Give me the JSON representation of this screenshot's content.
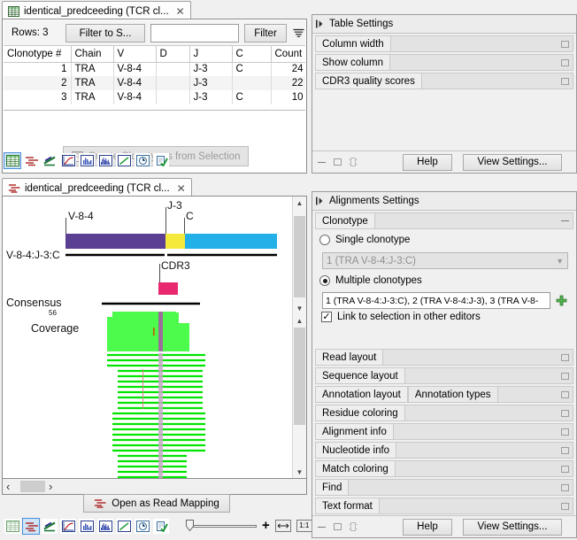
{
  "top_view": {
    "tab": {
      "title": "identical_predceeding (TCR cl...",
      "close": "✕",
      "icon": "table-grid-icon"
    },
    "toolbar": {
      "rows_label": "Rows: 3",
      "filter_to_selection": "Filter to S...",
      "search_value": "",
      "search_placeholder": "",
      "filter_button": "Filter",
      "filter_menu_icon": "filter-menu-icon"
    },
    "table": {
      "columns": [
        "Clonotype #",
        "Chain",
        "V",
        "D",
        "J",
        "C",
        "Count"
      ],
      "rows": [
        {
          "clonotype": "1",
          "chain": "TRA",
          "v": "V-8-4",
          "d": "",
          "j": "J-3",
          "c": "C",
          "count": "24"
        },
        {
          "clonotype": "2",
          "chain": "TRA",
          "v": "V-8-4",
          "d": "",
          "j": "J-3",
          "c": "",
          "count": "22"
        },
        {
          "clonotype": "3",
          "chain": "TRA",
          "v": "V-8-4",
          "d": "",
          "j": "J-3",
          "c": "C",
          "count": "10"
        }
      ]
    },
    "create_button": "Create Clonotypes from Selection",
    "view_icons": [
      "table-view-icon",
      "read-mapping-view-icon",
      "alignment-view-icon",
      "line-chart-view-icon",
      "histogram-view-icon",
      "bar-chart-view-icon",
      "trend-chart-view-icon",
      "circular-view-icon",
      "report-view-icon"
    ],
    "selected_view_icon": 0
  },
  "table_settings": {
    "header": "Table Settings",
    "expand_icon": "expand-arrow-icon",
    "groups": [
      {
        "label": "Column width",
        "icon": "restore-icon"
      },
      {
        "label": "Show column",
        "icon": "restore-icon"
      },
      {
        "label": "CDR3 quality scores",
        "icon": "restore-icon"
      }
    ],
    "footer": {
      "minimize_icon": "minimize-icon",
      "restore_icon": "restore-icon",
      "dock_icon": "dock-icon",
      "help": "Help",
      "view_settings": "View Settings..."
    }
  },
  "bottom_view": {
    "tab": {
      "title": "identical_predceeding (TCR cl...",
      "close": "✕",
      "icon": "read-mapping-icon"
    },
    "graphic": {
      "segment_labels": [
        "V-8-4",
        "J-3",
        "C"
      ],
      "reference_name": "V-8-4:J-3:C",
      "annotation_label": "CDR3",
      "consensus_label": "Consensus",
      "consensus_value": "56",
      "coverage_label": "Coverage",
      "colors": {
        "v_segment": "#5b3f93",
        "j_segment": "#f5e93b",
        "c_segment": "#23b0e8",
        "cdr3": "#e8286f",
        "coverage": "#4dfb4d",
        "read": "#00e400",
        "mismatch": "#9b6d9b"
      }
    },
    "hscroll": {
      "left_arrow": "‹",
      "right_arrow": "›"
    },
    "open_as_read_mapping": "Open as Read Mapping",
    "view_icons": [
      "table-view-icon",
      "read-mapping-view-icon",
      "alignment-view-icon",
      "line-chart-view-icon",
      "histogram-view-icon",
      "bar-chart-view-icon",
      "trend-chart-view-icon",
      "circular-view-icon",
      "report-view-icon"
    ],
    "selected_view_icon": 1,
    "zoom": {
      "slider_value": "0",
      "plus_label": "+",
      "fit_width_icon": "fit-width-icon",
      "zoom_one_to_one_label": "1:1"
    }
  },
  "alignments_settings": {
    "header": "Alignments Settings",
    "expand_icon": "expand-arrow-icon",
    "clonotype_group": {
      "label": "Clonotype",
      "collapse_icon": "collapse-icon",
      "single_option": "Single clonotype",
      "single_value": "1 (TRA V-8-4:J-3:C)",
      "single_selected": false,
      "multiple_option": "Multiple clonotypes",
      "multiple_value": "1 (TRA V-8-4:J-3:C), 2 (TRA V-8-4:J-3), 3 (TRA V-8-",
      "multiple_selected": true,
      "add_icon": "add-plus-icon",
      "link_checkbox_label": "Link to selection in other editors",
      "link_checkbox_checked": true,
      "link_checkbox_mark": "✓"
    },
    "groups": [
      {
        "label": "Read layout",
        "icon": "restore-icon",
        "sub": ""
      },
      {
        "label": "Sequence layout",
        "icon": "restore-icon",
        "sub": ""
      },
      {
        "label": "Annotation layout",
        "icon": "restore-icon",
        "sub": "Annotation types"
      },
      {
        "label": "Residue coloring",
        "icon": "restore-icon",
        "sub": ""
      },
      {
        "label": "Alignment info",
        "icon": "restore-icon",
        "sub": ""
      },
      {
        "label": "Nucleotide info",
        "icon": "restore-icon",
        "sub": ""
      },
      {
        "label": "Match coloring",
        "icon": "restore-icon",
        "sub": ""
      },
      {
        "label": "Find",
        "icon": "restore-icon",
        "sub": ""
      },
      {
        "label": "Text format",
        "icon": "restore-icon",
        "sub": ""
      }
    ],
    "footer": {
      "minimize_icon": "minimize-icon",
      "restore_icon": "restore-icon",
      "dock_icon": "dock-icon",
      "help": "Help",
      "view_settings": "View Settings..."
    }
  }
}
